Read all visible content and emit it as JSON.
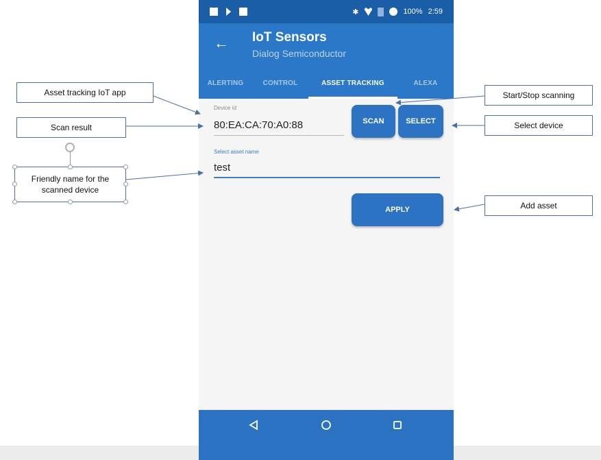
{
  "status_bar": {
    "battery_percent": "100%",
    "time": "2:59"
  },
  "app_bar": {
    "title": "IoT Sensors",
    "subtitle": "Dialog Semiconductor"
  },
  "tabs": [
    {
      "label": "ALERTING",
      "active": false
    },
    {
      "label": "CONTROL",
      "active": false
    },
    {
      "label": "ASSET TRACKING",
      "active": true
    },
    {
      "label": "ALEXA",
      "active": false
    }
  ],
  "form": {
    "device_id_label": "Device id",
    "device_id_value": "80:EA:CA:70:A0:88",
    "asset_name_label": "Select asset name",
    "asset_name_value": "test",
    "scan_button": "SCAN",
    "select_button": "SELECT",
    "apply_button": "APPLY"
  },
  "annotations": {
    "app": "Asset tracking IoT app",
    "scan_result": "Scan result",
    "friendly_name": "Friendly name for the scanned device",
    "start_stop": "Start/Stop scanning",
    "select_device": "Select device",
    "add_asset": "Add asset"
  },
  "colors": {
    "primary": "#2b78c9",
    "status_bar": "#1b5ea8",
    "button": "#2d73c4",
    "accent_underline": "#3d7cc9"
  },
  "icons": [
    "back-arrow-icon",
    "nav-back-icon",
    "nav-home-icon",
    "nav-recent-apps-icon",
    "wifi-icon",
    "bluetooth-icon",
    "clock-icon",
    "battery-icon"
  ]
}
